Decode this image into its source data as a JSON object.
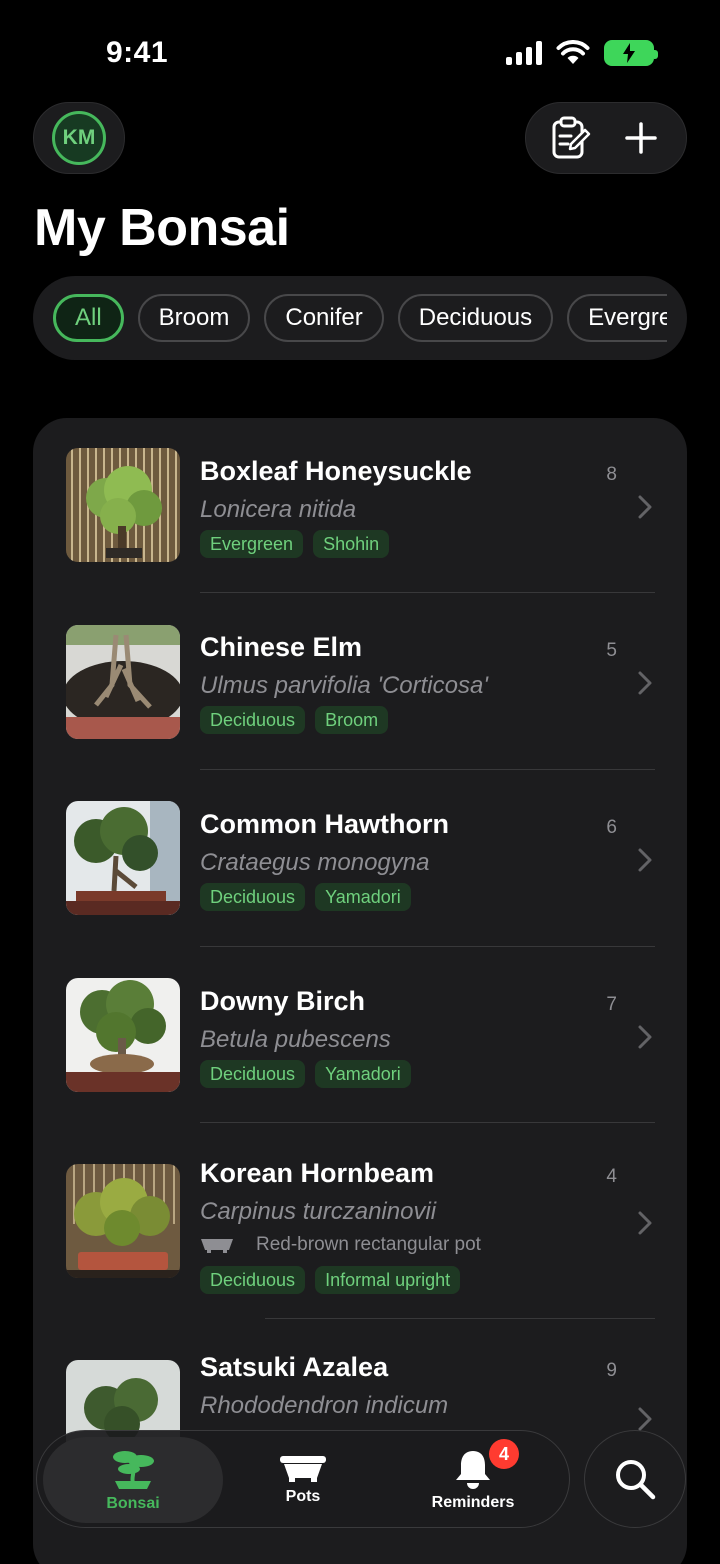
{
  "status_bar": {
    "time": "9:41"
  },
  "header": {
    "avatar_initials": "KM",
    "title": "My Bonsai"
  },
  "filters": [
    "All",
    "Broom",
    "Conifer",
    "Deciduous",
    "Evergreen"
  ],
  "trees": [
    {
      "name": "Boxleaf Honeysuckle",
      "scientific": "Lonicera nitida",
      "count": "8",
      "tags": [
        "Evergreen",
        "Shohin"
      ]
    },
    {
      "name": "Chinese Elm",
      "scientific": "Ulmus parvifolia 'Corticosa'",
      "count": "5",
      "tags": [
        "Deciduous",
        "Broom"
      ]
    },
    {
      "name": "Common Hawthorn",
      "scientific": "Crataegus monogyna",
      "count": "6",
      "tags": [
        "Deciduous",
        "Yamadori"
      ]
    },
    {
      "name": "Downy Birch",
      "scientific": "Betula pubescens",
      "count": "7",
      "tags": [
        "Deciduous",
        "Yamadori"
      ]
    },
    {
      "name": "Korean Hornbeam",
      "scientific": "Carpinus turczaninovii",
      "count": "4",
      "pot": "Red-brown rectangular pot",
      "tags": [
        "Deciduous",
        "Informal upright"
      ]
    },
    {
      "name": "Satsuki Azalea",
      "scientific": "Rhododendron indicum",
      "count": "9",
      "tags": []
    }
  ],
  "tabbar": {
    "tabs": [
      {
        "label": "Bonsai",
        "icon": "bonsai-icon",
        "active": true
      },
      {
        "label": "Pots",
        "icon": "pot-icon"
      },
      {
        "label": "Reminders",
        "icon": "bell-icon",
        "badge": "4"
      }
    ],
    "search_icon": "search-icon"
  },
  "colors": {
    "accent": "#46b85c",
    "card": "#1c1c1e",
    "background": "#000000",
    "badge": "#ff3b30"
  }
}
